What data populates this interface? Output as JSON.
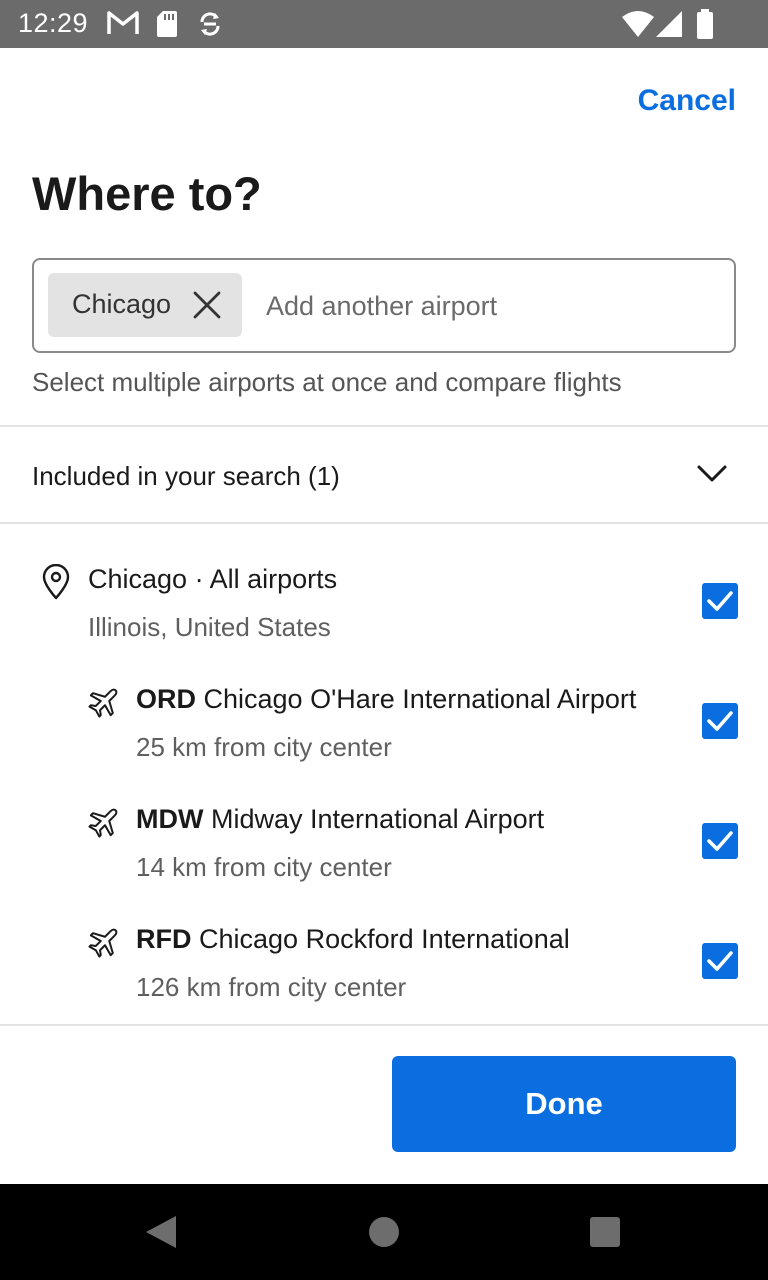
{
  "status_bar": {
    "time": "12:29"
  },
  "header": {
    "cancel_label": "Cancel",
    "title": "Where to?"
  },
  "search": {
    "selected_chip": "Chicago",
    "placeholder": "Add another airport",
    "helper": "Select multiple airports at once and compare flights"
  },
  "included": {
    "label": "Included in your search (1)"
  },
  "city": {
    "title": "Chicago · All airports",
    "subtitle": "Illinois, United States",
    "checked": true
  },
  "airports": [
    {
      "code": "ORD",
      "name": "Chicago O'Hare International Airport",
      "distance": "25 km from city center",
      "checked": true
    },
    {
      "code": "MDW",
      "name": "Midway International Airport",
      "distance": "14 km from city center",
      "checked": true
    },
    {
      "code": "RFD",
      "name": "Chicago Rockford International",
      "distance": "126 km from city center",
      "checked": true
    }
  ],
  "done_label": "Done",
  "colors": {
    "accent": "#0a6ee0",
    "status_bar": "#6b6b6b",
    "chip": "#e3e3e3"
  }
}
